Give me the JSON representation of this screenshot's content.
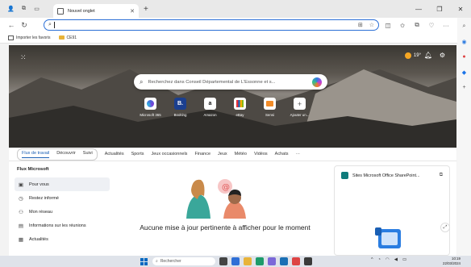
{
  "browser": {
    "tab_title": "Nouvel onglet",
    "favorites": [
      {
        "label": "Importer les favoris",
        "icon": "import-icon"
      },
      {
        "label": "CE91",
        "icon": "folder-icon"
      }
    ]
  },
  "hero": {
    "temperature": "19°",
    "search_placeholder": "Recherchez dans Conseil Départemental de L'Essonne et s...",
    "quick_links": [
      {
        "label": "Microsoft 365",
        "glyph": "",
        "color": "#4a63d8"
      },
      {
        "label": "Booking",
        "glyph": "B.",
        "color": "#1b3f8f"
      },
      {
        "label": "Amazon",
        "glyph": "a",
        "color": "#111111"
      },
      {
        "label": "eBay",
        "glyph": "",
        "color": "#e53238"
      },
      {
        "label": "Sensi",
        "glyph": "",
        "color": "#f28c28"
      },
      {
        "label": "Ajouter un...",
        "glyph": "+",
        "color": "#666666"
      }
    ]
  },
  "feed_tabs": {
    "pill": [
      "Flux de travail",
      "Découvrir",
      "Suivi"
    ],
    "others": [
      "Actualités",
      "Sports",
      "Jeux occasionnels",
      "Finance",
      "Jeux",
      "Météo",
      "Vidéos",
      "Achats",
      "···"
    ]
  },
  "left_nav": {
    "heading": "Flux Microsoft",
    "items": [
      {
        "label": "Pour vous",
        "icon": "for-you-icon",
        "glyph": "▣"
      },
      {
        "label": "Restez informé",
        "icon": "clock-icon",
        "glyph": "◷"
      },
      {
        "label": "Mon réseau",
        "icon": "people-icon",
        "glyph": "⚇"
      },
      {
        "label": "Informations sur les réunions",
        "icon": "calendar-icon",
        "glyph": "▤"
      },
      {
        "label": "Actualités",
        "icon": "news-icon",
        "glyph": "▦"
      }
    ]
  },
  "empty_state": {
    "title": "Aucune mise à jour pertinente à afficher pour le moment"
  },
  "right_card": {
    "title": "Sites Microsoft Office SharePoint..."
  },
  "taskbar": {
    "search_placeholder": "Rechercher",
    "time": "10:19",
    "date": "22/03/2024"
  }
}
